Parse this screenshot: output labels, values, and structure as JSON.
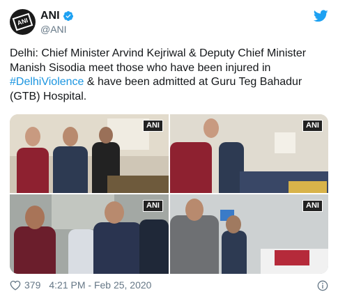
{
  "author": {
    "display_name": "ANI",
    "handle": "@ANI",
    "avatar_text": "ANI"
  },
  "tweet": {
    "text_before_hashtag": "Delhi: Chief Minister Arvind Kejriwal & Deputy Chief Minister Manish Sisodia meet those who have been injured in ",
    "hashtag": "#DelhiViolence",
    "text_after_hashtag": " & have been admitted at Guru Teg Bahadur (GTB) Hospital."
  },
  "media": {
    "photos": [
      {
        "badge": "ANI"
      },
      {
        "badge": "ANI"
      },
      {
        "badge": "ANI"
      },
      {
        "badge": "ANI"
      }
    ]
  },
  "footer": {
    "like_count": "379",
    "timestamp": "4:21 PM - Feb 25, 2020"
  },
  "colors": {
    "link": "#1b95e0",
    "muted": "#657786",
    "verified": "#1da1f2"
  },
  "icons": [
    "verified-badge-icon",
    "twitter-bird-icon",
    "heart-icon",
    "info-icon"
  ]
}
